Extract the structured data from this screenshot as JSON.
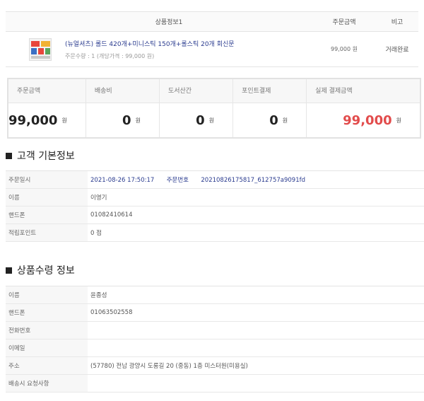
{
  "order_table": {
    "headers": {
      "product": "상품정보1",
      "amount": "주문금액",
      "etc": "비고"
    },
    "item": {
      "name": "(뉴얼셔츠) 롤드 420개+미니스틱 150개+롤스틱 20개 회신문",
      "option": "주문수량 : 1  (개당가격 : 99,000 원)",
      "amount": "99,000 원",
      "status": "거래완료"
    }
  },
  "summary": [
    {
      "label": "주문금액",
      "value": "99,000",
      "unit": "원",
      "highlight": false
    },
    {
      "label": "배송비",
      "value": "0",
      "unit": "원",
      "highlight": false
    },
    {
      "label": "도서산간",
      "value": "0",
      "unit": "원",
      "highlight": false
    },
    {
      "label": "포인트결제",
      "value": "0",
      "unit": "원",
      "highlight": false
    },
    {
      "label": "실제 결제금액",
      "value": "99,000",
      "unit": "원",
      "highlight": true
    }
  ],
  "customer": {
    "title": "고객 기본정보",
    "rows": [
      {
        "label": "주문일시",
        "datetime": "2021-08-26 17:50:17",
        "order_label": "주문번호",
        "order_no": "20210826175817_612757a9091fd"
      },
      {
        "label": "이름",
        "value": "이영기"
      },
      {
        "label": "핸드폰",
        "value": "01082410614"
      },
      {
        "label": "적립포인트",
        "value": "0 점"
      }
    ]
  },
  "shipping": {
    "title": "상품수령 정보",
    "rows": [
      {
        "label": "이름",
        "value": "윤종성"
      },
      {
        "label": "핸드폰",
        "value": "01063502558"
      },
      {
        "label": "전화번호",
        "value": ""
      },
      {
        "label": "이메일",
        "value": ""
      },
      {
        "label": "주소",
        "value": "(57780) 전남 광양시 도롱길 20 (중동) 1층 미스터원(미용실)"
      },
      {
        "label": "배송시 요청사항",
        "value": ""
      }
    ]
  },
  "colors": {
    "accent_red": "#e24c4c",
    "link_blue": "#2a3b8f"
  }
}
